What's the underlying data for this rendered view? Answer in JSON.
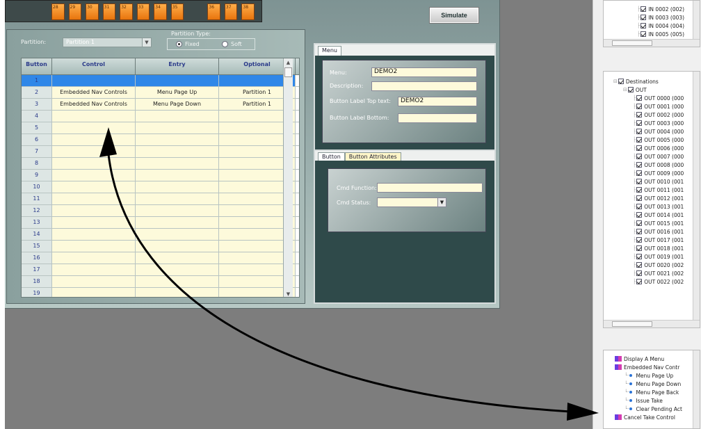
{
  "toolbar": {
    "buttons": [
      "28",
      "29",
      "30",
      "31",
      "32",
      "33",
      "34",
      "35",
      "36",
      "37",
      "38"
    ],
    "simulate_label": "Simulate"
  },
  "partition": {
    "label": "Partition:",
    "selected": "Partition 1",
    "type_label": "Partition Type:",
    "options": [
      "Fixed",
      "Soft"
    ],
    "selected_type": "Fixed"
  },
  "grid": {
    "headers": [
      "Button",
      "Control",
      "Entry",
      "Optional"
    ],
    "rows": [
      [
        "1",
        "",
        "",
        ""
      ],
      [
        "2",
        "Embedded Nav Controls",
        "Menu Page Up",
        "Partition 1"
      ],
      [
        "3",
        "Embedded Nav Controls",
        "Menu Page Down",
        "Partition 1"
      ],
      [
        "4",
        "",
        "",
        ""
      ],
      [
        "5",
        "",
        "",
        ""
      ],
      [
        "6",
        "",
        "",
        ""
      ],
      [
        "7",
        "",
        "",
        ""
      ],
      [
        "8",
        "",
        "",
        ""
      ],
      [
        "9",
        "",
        "",
        ""
      ],
      [
        "10",
        "",
        "",
        ""
      ],
      [
        "11",
        "",
        "",
        ""
      ],
      [
        "12",
        "",
        "",
        ""
      ],
      [
        "13",
        "",
        "",
        ""
      ],
      [
        "14",
        "",
        "",
        ""
      ],
      [
        "15",
        "",
        "",
        ""
      ],
      [
        "16",
        "",
        "",
        ""
      ],
      [
        "17",
        "",
        "",
        ""
      ],
      [
        "18",
        "",
        "",
        ""
      ],
      [
        "19",
        "",
        "",
        ""
      ]
    ]
  },
  "menu_panel": {
    "tab": "Menu",
    "menu_label": "Menu:",
    "menu_value": "DEMO2",
    "description_label": "Description:",
    "description_value": "",
    "label_top_label": "Button Label Top text:",
    "label_top_value": "DEMO2",
    "label_bottom_label": "Button Label Bottom:",
    "label_bottom_value": ""
  },
  "button_panel": {
    "tabs": [
      "Button",
      "Button Attributes"
    ],
    "cmd_function_label": "Cmd Function:",
    "cmd_function_value": "",
    "cmd_status_label": "Cmd Status:",
    "cmd_status_value": ""
  },
  "sources_tree": {
    "items": [
      "IN 0002 (002)",
      "IN 0003 (003)",
      "IN 0004 (004)",
      "IN 0005 (005)"
    ]
  },
  "destinations_tree": {
    "root": "Destinations",
    "group": "OUT",
    "items": [
      "OUT 0000 (000",
      "OUT 0001 (000",
      "OUT 0002 (000",
      "OUT 0003 (000",
      "OUT 0004 (000",
      "OUT 0005 (000",
      "OUT 0006 (000",
      "OUT 0007 (000",
      "OUT 0008 (000",
      "OUT 0009 (000",
      "OUT 0010 (001",
      "OUT 0011 (001",
      "OUT 0012 (001",
      "OUT 0013 (001",
      "OUT 0014 (001",
      "OUT 0015 (001",
      "OUT 0016 (001",
      "OUT 0017 (001",
      "OUT 0018 (001",
      "OUT 0019 (001",
      "OUT 0020 (002",
      "OUT 0021 (002",
      "OUT 0022 (002"
    ]
  },
  "commands_tree": {
    "display_menu": "Display A Menu",
    "embedded_nav": "Embedded Nav Contr",
    "items": [
      "Menu Page Up",
      "Menu Page Down",
      "Menu Page Back",
      "Issue Take",
      "Clear Pending Act"
    ],
    "next_group": "Cancel Take Control"
  },
  "colors": {
    "accent_orange": "#f08a24",
    "selected_row": "#2f87e8",
    "cell_bg": "#fdfadb",
    "panel_dark": "#2f4a4a"
  }
}
